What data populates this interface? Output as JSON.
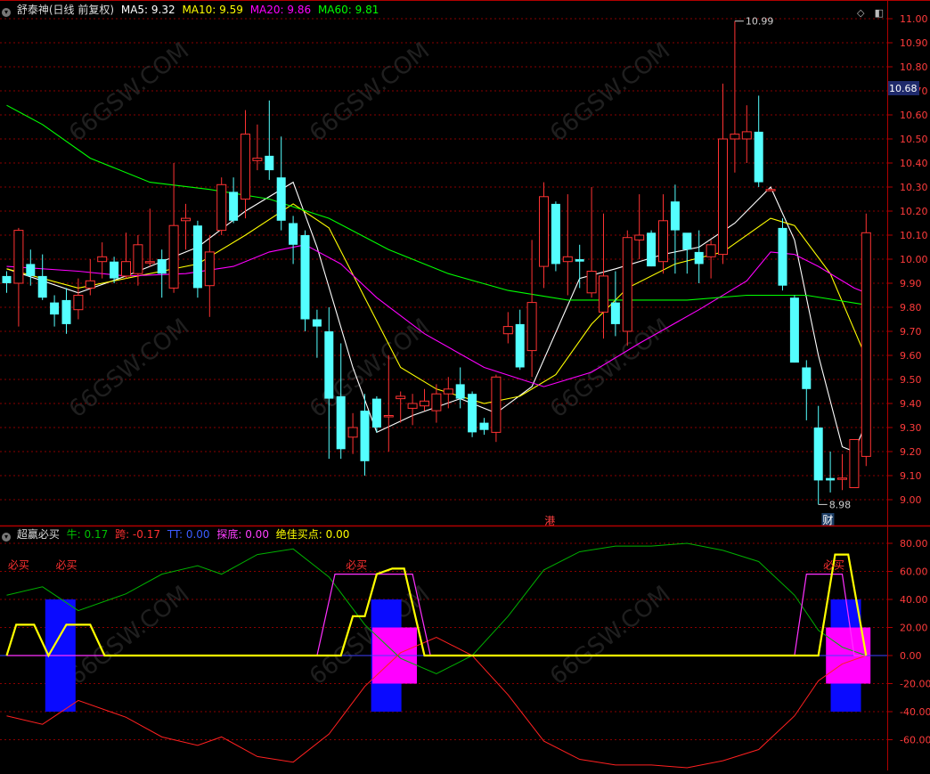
{
  "main": {
    "stock_name": "舒泰神(日线 前复权)",
    "ma": [
      {
        "label": "MA5: 9.32",
        "color": "#ffffff"
      },
      {
        "label": "MA10: 9.59",
        "color": "#ffff00"
      },
      {
        "label": "MA20: 9.86",
        "color": "#ff00ff"
      },
      {
        "label": "MA60: 9.81",
        "color": "#00ff00"
      }
    ],
    "price_axis": [
      "11.10",
      "11.00",
      "10.90",
      "10.80",
      "10.70",
      "10.60",
      "10.50",
      "10.40",
      "10.30",
      "10.20",
      "10.10",
      "10.00",
      "9.90",
      "9.80",
      "9.70",
      "9.60",
      "9.50",
      "9.40",
      "9.30",
      "9.20",
      "9.10",
      "9.00"
    ],
    "current_price": "10.68",
    "high_label": "10.99",
    "low_label": "8.98",
    "marker_gang": "港",
    "marker_cai": "财"
  },
  "sub": {
    "indicator_name": "超赢必买",
    "params": [
      {
        "label": "牛: 0.17",
        "color": "#00c000"
      },
      {
        "label": "跨: -0.17",
        "color": "#ff3030"
      },
      {
        "label": "TT: 0.00",
        "color": "#3a5bff"
      },
      {
        "label": "探底: 0.00",
        "color": "#ff40ff"
      },
      {
        "label": "绝佳买点: 0.00",
        "color": "#ffff00"
      }
    ],
    "axis": [
      "80.00",
      "60.00",
      "40.00",
      "20.00",
      "0.00",
      "-20.00",
      "-40.00",
      "-60.00"
    ],
    "signal_text": "必买"
  },
  "colors": {
    "up": "#ff3232",
    "down": "#54ffff",
    "grid": "#8a0000",
    "axis_text": "#ff3b3b",
    "panel_border": "#b00000"
  },
  "chart_data": {
    "type": "candlestick",
    "candles": [
      [
        9.93,
        9.9,
        9.95,
        9.86
      ],
      [
        9.9,
        10.12,
        10.13,
        9.72
      ],
      [
        9.98,
        9.93,
        10.04,
        9.89
      ],
      [
        9.93,
        9.84,
        10.02,
        9.83
      ],
      [
        9.82,
        9.77,
        9.85,
        9.72
      ],
      [
        9.83,
        9.73,
        9.88,
        9.69
      ],
      [
        9.79,
        9.85,
        9.92,
        9.75
      ],
      [
        9.88,
        9.91,
        10.0,
        9.85
      ],
      [
        9.99,
        10.01,
        10.07,
        9.92
      ],
      [
        9.99,
        9.92,
        10.01,
        9.9
      ],
      [
        9.93,
        9.99,
        10.11,
        9.92
      ],
      [
        9.94,
        10.06,
        10.1,
        9.89
      ],
      [
        9.99,
        9.99,
        10.21,
        9.97
      ],
      [
        10.0,
        9.94,
        10.04,
        9.84
      ],
      [
        9.88,
        10.14,
        10.4,
        9.86
      ],
      [
        10.16,
        10.17,
        10.23,
        10.04
      ],
      [
        10.14,
        9.88,
        10.16,
        9.84
      ],
      [
        9.89,
        10.03,
        10.1,
        9.76
      ],
      [
        10.12,
        10.31,
        10.34,
        10.1
      ],
      [
        10.28,
        10.16,
        10.34,
        10.15
      ],
      [
        10.25,
        10.52,
        10.62,
        10.17
      ],
      [
        10.41,
        10.42,
        10.56,
        10.37
      ],
      [
        10.43,
        10.37,
        10.66,
        10.33
      ],
      [
        10.34,
        10.16,
        10.51,
        10.12
      ],
      [
        10.15,
        10.06,
        10.18,
        9.98
      ],
      [
        10.1,
        9.75,
        10.12,
        9.7
      ],
      [
        9.75,
        9.72,
        9.79,
        9.59
      ],
      [
        9.7,
        9.42,
        9.8,
        9.17
      ],
      [
        9.43,
        9.21,
        9.65,
        9.17
      ],
      [
        9.26,
        9.3,
        9.36,
        9.19
      ],
      [
        9.37,
        9.16,
        9.44,
        9.1
      ],
      [
        9.42,
        9.3,
        9.43,
        9.28
      ],
      [
        9.35,
        9.35,
        9.6,
        9.2
      ],
      [
        9.42,
        9.43,
        9.45,
        9.32
      ],
      [
        9.38,
        9.4,
        9.44,
        9.31
      ],
      [
        9.39,
        9.41,
        9.46,
        9.37
      ],
      [
        9.37,
        9.44,
        9.48,
        9.32
      ],
      [
        9.44,
        9.46,
        9.51,
        9.38
      ],
      [
        9.48,
        9.42,
        9.55,
        9.38
      ],
      [
        9.44,
        9.28,
        9.45,
        9.26
      ],
      [
        9.32,
        9.29,
        9.34,
        9.27
      ],
      [
        9.28,
        9.51,
        9.52,
        9.24
      ],
      [
        9.69,
        9.72,
        9.78,
        9.65
      ],
      [
        9.73,
        9.55,
        9.79,
        9.54
      ],
      [
        9.62,
        9.82,
        10.08,
        9.51
      ],
      [
        9.97,
        10.26,
        10.32,
        9.88
      ],
      [
        10.23,
        9.98,
        10.24,
        9.95
      ],
      [
        9.99,
        10.01,
        10.27,
        9.85
      ],
      [
        10.0,
        9.99,
        10.06,
        9.88
      ],
      [
        9.86,
        9.95,
        10.3,
        9.84
      ],
      [
        9.78,
        9.93,
        10.19,
        9.67
      ],
      [
        9.82,
        9.73,
        9.95,
        9.68
      ],
      [
        9.7,
        10.09,
        10.12,
        9.64
      ],
      [
        10.08,
        10.1,
        10.27,
        10.0
      ],
      [
        10.11,
        9.97,
        10.12,
        9.97
      ],
      [
        9.99,
        10.16,
        10.27,
        9.94
      ],
      [
        10.24,
        10.12,
        10.31,
        9.94
      ],
      [
        10.11,
        10.04,
        10.1,
        9.94
      ],
      [
        10.03,
        9.98,
        10.12,
        9.9
      ],
      [
        10.01,
        10.06,
        10.08,
        9.92
      ],
      [
        10.02,
        10.5,
        10.73,
        9.98
      ],
      [
        10.5,
        10.52,
        10.99,
        10.36
      ],
      [
        10.5,
        10.53,
        10.64,
        10.4
      ],
      [
        10.53,
        10.32,
        10.68,
        10.3
      ],
      [
        10.29,
        10.29,
        10.29,
        10.29
      ],
      [
        10.13,
        9.89,
        10.17,
        9.87
      ],
      [
        9.84,
        9.57,
        9.85,
        9.57
      ],
      [
        9.55,
        9.46,
        9.58,
        9.33
      ],
      [
        9.3,
        9.08,
        9.39,
        8.98
      ],
      [
        9.09,
        9.08,
        9.2,
        9.03
      ],
      [
        9.09,
        9.09,
        9.19,
        9.04
      ],
      [
        9.05,
        9.25,
        9.25,
        9.05
      ],
      [
        9.18,
        10.11,
        10.19,
        9.14
      ]
    ],
    "ma_series": [
      {
        "name": "MA5",
        "color": "#ffffff",
        "points": [
          [
            0,
            9.96
          ],
          [
            6,
            9.86
          ],
          [
            10,
            9.93
          ],
          [
            16,
            10.05
          ],
          [
            20,
            10.2
          ],
          [
            24,
            10.32
          ],
          [
            26,
            10.05
          ],
          [
            29,
            9.55
          ],
          [
            31,
            9.28
          ],
          [
            34,
            9.35
          ],
          [
            38,
            9.42
          ],
          [
            41,
            9.36
          ],
          [
            44,
            9.47
          ],
          [
            48,
            9.92
          ],
          [
            51,
            9.96
          ],
          [
            55,
            10.02
          ],
          [
            58,
            10.05
          ],
          [
            61,
            10.15
          ],
          [
            64,
            10.3
          ],
          [
            66,
            10.08
          ],
          [
            68,
            9.6
          ],
          [
            70,
            9.22
          ],
          [
            71,
            9.2
          ],
          [
            72,
            9.32
          ]
        ]
      },
      {
        "name": "MA10",
        "color": "#ffff00",
        "points": [
          [
            0,
            9.96
          ],
          [
            6,
            9.88
          ],
          [
            10,
            9.92
          ],
          [
            16,
            9.98
          ],
          [
            20,
            10.1
          ],
          [
            24,
            10.23
          ],
          [
            27,
            10.13
          ],
          [
            30,
            9.84
          ],
          [
            33,
            9.55
          ],
          [
            36,
            9.46
          ],
          [
            40,
            9.4
          ],
          [
            43,
            9.43
          ],
          [
            46,
            9.52
          ],
          [
            49,
            9.73
          ],
          [
            52,
            9.88
          ],
          [
            56,
            9.98
          ],
          [
            60,
            10.03
          ],
          [
            64,
            10.17
          ],
          [
            66,
            10.14
          ],
          [
            69,
            9.94
          ],
          [
            72,
            9.59
          ]
        ]
      },
      {
        "name": "MA20",
        "color": "#ff00ff",
        "points": [
          [
            0,
            9.97
          ],
          [
            6,
            9.95
          ],
          [
            10,
            9.93
          ],
          [
            15,
            9.94
          ],
          [
            19,
            9.97
          ],
          [
            22,
            10.03
          ],
          [
            25,
            10.06
          ],
          [
            28,
            9.98
          ],
          [
            31,
            9.84
          ],
          [
            35,
            9.69
          ],
          [
            40,
            9.55
          ],
          [
            45,
            9.47
          ],
          [
            49,
            9.53
          ],
          [
            53,
            9.65
          ],
          [
            58,
            9.79
          ],
          [
            62,
            9.91
          ],
          [
            64,
            10.03
          ],
          [
            66,
            10.02
          ],
          [
            68,
            9.97
          ],
          [
            71,
            9.88
          ],
          [
            72,
            9.86
          ]
        ]
      },
      {
        "name": "MA60",
        "color": "#00ff00",
        "points": [
          [
            0,
            10.64
          ],
          [
            3,
            10.56
          ],
          [
            7,
            10.42
          ],
          [
            12,
            10.32
          ],
          [
            17,
            10.29
          ],
          [
            22,
            10.25
          ],
          [
            27,
            10.17
          ],
          [
            32,
            10.04
          ],
          [
            37,
            9.94
          ],
          [
            42,
            9.87
          ],
          [
            47,
            9.83
          ],
          [
            52,
            9.83
          ],
          [
            57,
            9.83
          ],
          [
            62,
            9.85
          ],
          [
            67,
            9.85
          ],
          [
            72,
            9.81
          ]
        ]
      }
    ],
    "indicator": {
      "bull": [
        [
          0,
          43
        ],
        [
          3,
          49
        ],
        [
          6,
          32
        ],
        [
          10,
          44
        ],
        [
          13,
          58
        ],
        [
          16,
          64
        ],
        [
          18,
          58
        ],
        [
          21,
          72
        ],
        [
          24,
          76
        ],
        [
          27,
          56
        ],
        [
          30,
          22
        ],
        [
          33,
          -2
        ],
        [
          36,
          -13
        ],
        [
          39,
          0
        ],
        [
          42,
          28
        ],
        [
          45,
          61
        ],
        [
          48,
          74
        ],
        [
          51,
          78
        ],
        [
          54,
          78
        ],
        [
          57,
          80
        ],
        [
          60,
          75
        ],
        [
          63,
          67
        ],
        [
          66,
          43
        ],
        [
          68,
          18
        ],
        [
          70,
          6
        ],
        [
          72,
          0
        ]
      ],
      "bear": [
        [
          0,
          -43
        ],
        [
          3,
          -49
        ],
        [
          6,
          -32
        ],
        [
          10,
          -44
        ],
        [
          13,
          -58
        ],
        [
          16,
          -64
        ],
        [
          18,
          -58
        ],
        [
          21,
          -72
        ],
        [
          24,
          -76
        ],
        [
          27,
          -56
        ],
        [
          30,
          -22
        ],
        [
          33,
          2
        ],
        [
          36,
          13
        ],
        [
          39,
          0
        ],
        [
          42,
          -28
        ],
        [
          45,
          -61
        ],
        [
          48,
          -74
        ],
        [
          51,
          -78
        ],
        [
          54,
          -78
        ],
        [
          57,
          -80
        ],
        [
          60,
          -75
        ],
        [
          63,
          -67
        ],
        [
          66,
          -43
        ],
        [
          68,
          -18
        ],
        [
          70,
          -6
        ],
        [
          72,
          0
        ]
      ],
      "bottom_fish": [
        [
          0,
          0
        ],
        [
          26,
          0
        ],
        [
          27.5,
          58
        ],
        [
          34,
          58
        ],
        [
          35.5,
          0
        ],
        [
          66,
          0
        ],
        [
          67,
          58
        ],
        [
          70,
          58
        ],
        [
          71,
          0
        ],
        [
          72,
          0
        ]
      ],
      "best_buy": [
        [
          0,
          0
        ],
        [
          0.8,
          22
        ],
        [
          2.3,
          22
        ],
        [
          3.5,
          0
        ],
        [
          5,
          22
        ],
        [
          7,
          22
        ],
        [
          8.2,
          0
        ],
        [
          28,
          0
        ],
        [
          29,
          28
        ],
        [
          30,
          28
        ],
        [
          31,
          58
        ],
        [
          32.3,
          62
        ],
        [
          33.3,
          62
        ],
        [
          35,
          0
        ],
        [
          68,
          0
        ],
        [
          69.4,
          72
        ],
        [
          70.5,
          72
        ],
        [
          72,
          0
        ]
      ],
      "blue_bars": [
        [
          4.5,
          40,
          -40
        ],
        [
          31.8,
          40,
          -40
        ],
        [
          70.3,
          40,
          -40
        ]
      ],
      "magenta_bars": [
        [
          32.5,
          20,
          -20
        ],
        [
          70.5,
          20,
          -20
        ]
      ],
      "signals": [
        1,
        5,
        29.3,
        69.3
      ]
    }
  }
}
